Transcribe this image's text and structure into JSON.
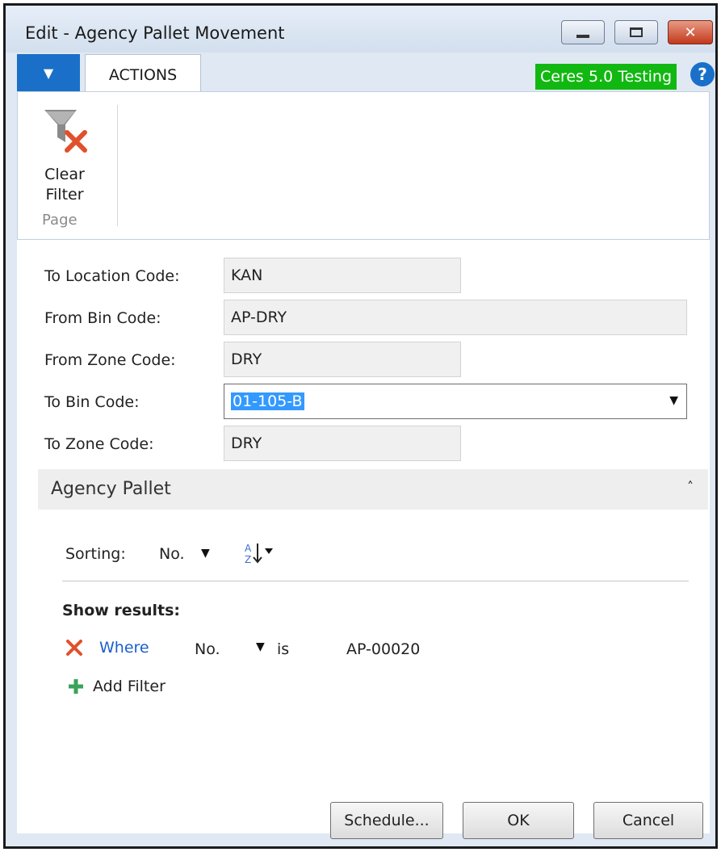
{
  "window": {
    "title": "Edit - Agency Pallet Movement"
  },
  "ribbon": {
    "tabs": [
      "ACTIONS"
    ],
    "environment_badge": "Ceres 5.0 Testing",
    "help_glyph": "?",
    "actions": [
      {
        "label_line1": "Clear",
        "label_line2": "Filter",
        "icon": "clear-filter-icon"
      }
    ],
    "group_label": "Page"
  },
  "fields": [
    {
      "label": "To Location Code:",
      "value": "KAN"
    },
    {
      "label": "From Bin Code:",
      "value": "AP-DRY"
    },
    {
      "label": "From Zone Code:",
      "value": "DRY"
    },
    {
      "label": "To Bin Code:",
      "value": "01-105-B"
    },
    {
      "label": "To Zone Code:",
      "value": "DRY"
    }
  ],
  "fasttab": {
    "title": "Agency Pallet",
    "chevron": "˄"
  },
  "sorting": {
    "label": "Sorting:",
    "field": "No."
  },
  "filters": {
    "heading": "Show results:",
    "rows": [
      {
        "keyword": "Where",
        "field": "No.",
        "operator": "is",
        "value": "AP-00020"
      }
    ],
    "add_label": "Add Filter"
  },
  "buttons": {
    "schedule": "Schedule...",
    "ok": "OK",
    "cancel": "Cancel"
  },
  "colors": {
    "accent": "#1a70c8",
    "badge": "#12b812",
    "close": "#c2391c",
    "selection": "#3399ff",
    "link": "#1a5fd0"
  }
}
